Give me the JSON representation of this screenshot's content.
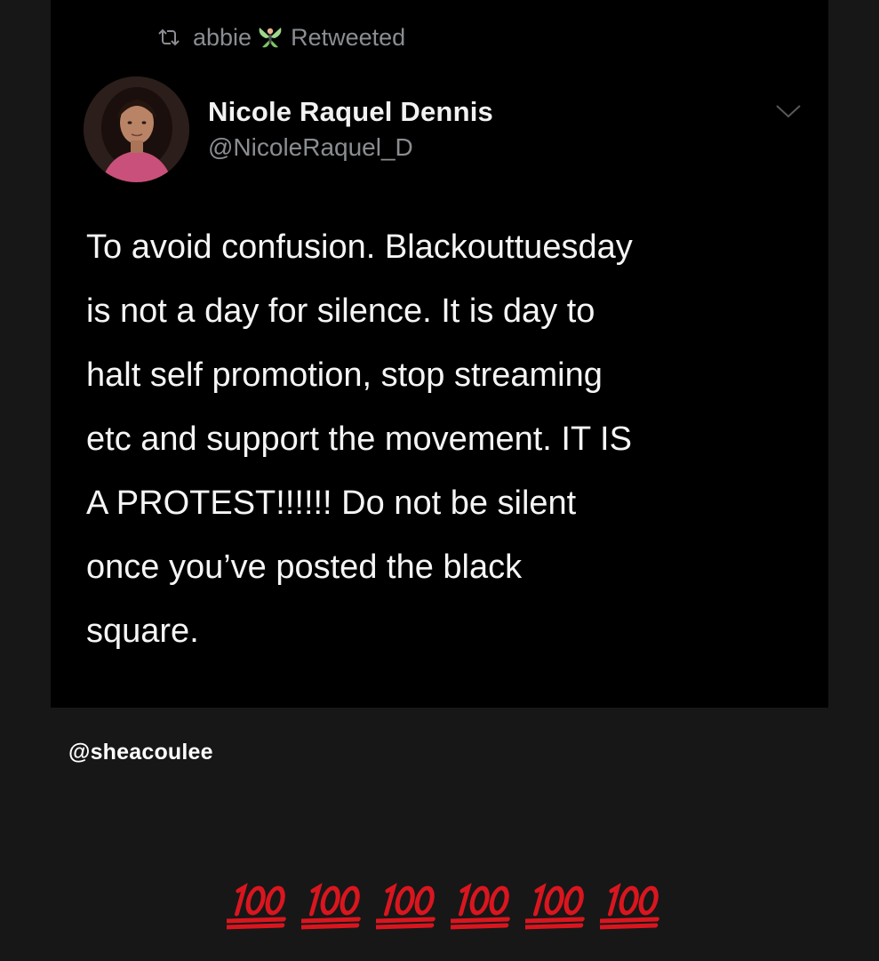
{
  "retweet": {
    "icon": "retweet-icon",
    "user": "abbie",
    "emoji": "fairy-icon",
    "label": "Retweeted"
  },
  "tweet": {
    "author_name": "Nicole Raquel Dennis",
    "author_handle": "@NicoleRaquel_D",
    "text": "To avoid confusion. Blackouttuesday\nis not a day for silence. It is day to\nhalt self promotion, stop streaming\netc and support the movement. IT IS\nA PROTEST!!!!!! Do not be silent\nonce you’ve posted the black\nsquare.",
    "menu_icon": "chevron-down-icon"
  },
  "caption": {
    "tag": "@sheacoulee",
    "emojis": [
      "hundred-points-icon",
      "hundred-points-icon",
      "hundred-points-icon",
      "hundred-points-icon",
      "hundred-points-icon",
      "hundred-points-icon"
    ]
  },
  "colors": {
    "background": "#171717",
    "card": "#000000",
    "muted_text": "#8a8d91",
    "primary_text": "#f5f5f5",
    "emoji_red": "#d9161f"
  }
}
